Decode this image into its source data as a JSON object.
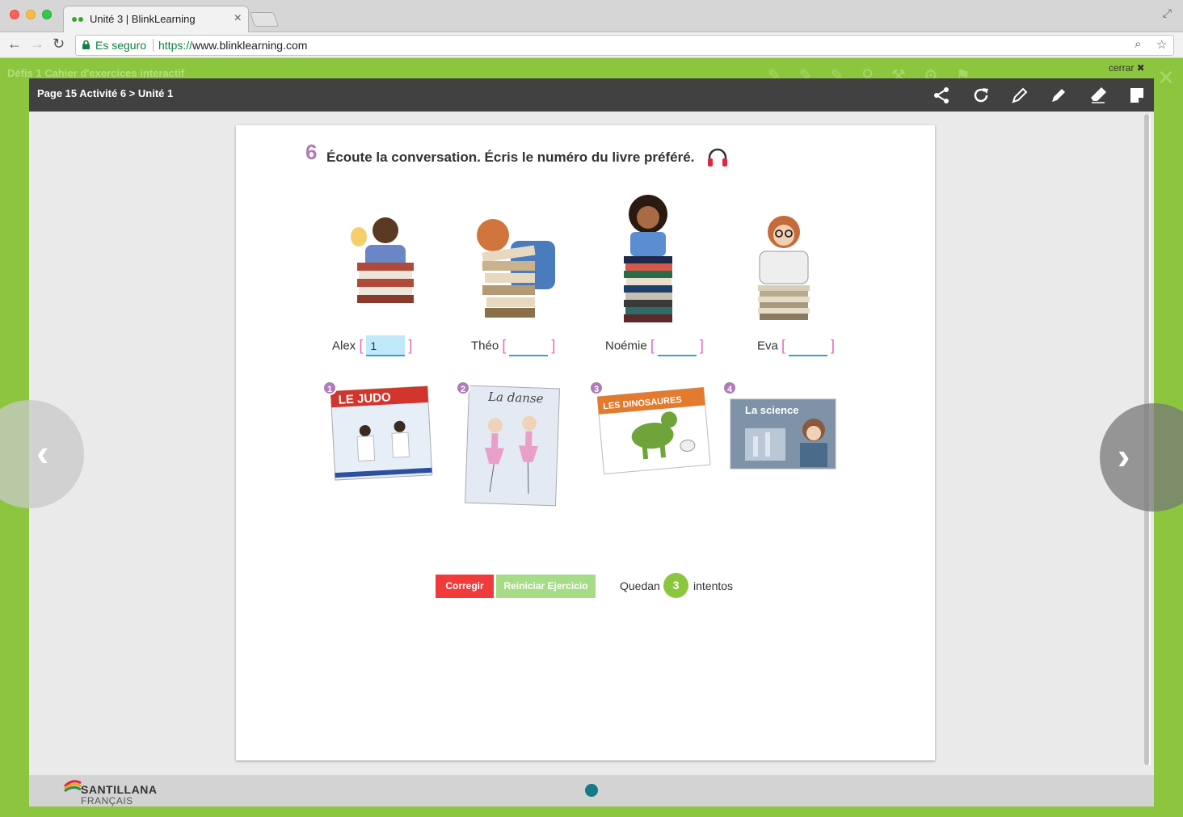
{
  "browser": {
    "tab_title": "Unité 3 | BlinkLearning",
    "tab_close": "×",
    "secure_label": "Es seguro",
    "url_scheme": "https://",
    "url_host": "www.blinklearning.com"
  },
  "app": {
    "title": "Défis 1 Cahier d'exercices interactif",
    "close_label": "cerrar ✖"
  },
  "modal": {
    "breadcrumb": "Page 15 Activité 6 > Unité 1",
    "tools": [
      "share-icon",
      "refresh-icon",
      "pencil-icon",
      "marker-icon",
      "eraser-icon",
      "sticky-note-icon"
    ]
  },
  "exercise": {
    "number": "6",
    "instruction": "Écoute la conversation. Écris le numéro du livre préféré.",
    "answers": [
      {
        "name": "Alex",
        "value": "1"
      },
      {
        "name": "Théo",
        "value": ""
      },
      {
        "name": "Noémie",
        "value": ""
      },
      {
        "name": "Eva",
        "value": ""
      }
    ],
    "books": [
      {
        "number": "1",
        "title": "LE JUDO"
      },
      {
        "number": "2",
        "title": "La danse"
      },
      {
        "number": "3",
        "title": "LES DINOSAURES"
      },
      {
        "number": "4",
        "title": "La science"
      }
    ]
  },
  "controls": {
    "check_label": "Corregir",
    "reset_label": "Reiniciar Ejercicio",
    "remaining_prefix": "Quedan",
    "remaining_count": "3",
    "remaining_suffix": "intentos"
  },
  "footer": {
    "brand": "SANTILLANA",
    "brand_sub": "FRANÇAIS"
  },
  "colors": {
    "green": "#8cc63f",
    "header": "#414141",
    "accent_purple": "#b07bb7",
    "check_red": "#f13a3a",
    "reset_green": "#a6dc86"
  }
}
